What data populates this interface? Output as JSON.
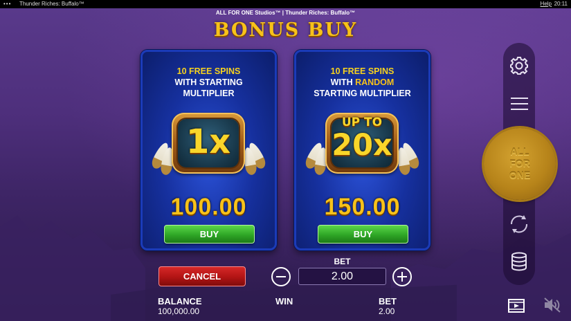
{
  "topbar": {
    "menu_dots": "•••",
    "window_title": "Thunder Riches: Buffalo™",
    "help_label": "Help",
    "clock": "20:11"
  },
  "header": {
    "studio_line": "ALL FOR ONE Studios™ | Thunder Riches: Buffalo™",
    "title": "BONUS BUY"
  },
  "offers": [
    {
      "heading_line1": "10 FREE SPINS",
      "heading_line2": "WITH STARTING",
      "heading_line3": "MULTIPLIER",
      "badge": "1x",
      "price": "100.00",
      "buy_label": "BUY"
    },
    {
      "heading_line1": "10 FREE SPINS",
      "heading_line2_pre": "WITH ",
      "heading_line2_highlight": "RANDOM",
      "heading_line3": "STARTING MULTIPLIER",
      "badge_top": "UP TO",
      "badge": "20x",
      "price": "150.00",
      "buy_label": "BUY"
    }
  ],
  "spin_button": {
    "line1": "ALL",
    "line2": "FOR",
    "line3": "ONE"
  },
  "controls": {
    "cancel_label": "CANCEL",
    "bet_label": "BET",
    "bet_value": "2.00"
  },
  "footer": {
    "balance_label": "BALANCE",
    "balance_value": "100,000.00",
    "win_label": "WIN",
    "bet_label": "BET",
    "bet_value": "2.00"
  },
  "icons": [
    "gear-icon",
    "hamburger-menu-icon",
    "autoplay-icon",
    "coin-stack-icon",
    "video-icon",
    "sound-muted-icon",
    "minus-icon",
    "plus-icon"
  ],
  "colors": {
    "title_gold": "#f7c21a",
    "buy_green": "#2ea626",
    "cancel_red": "#b11414",
    "card_blue": "#16309e",
    "background_purple": "#4e2f7c"
  }
}
